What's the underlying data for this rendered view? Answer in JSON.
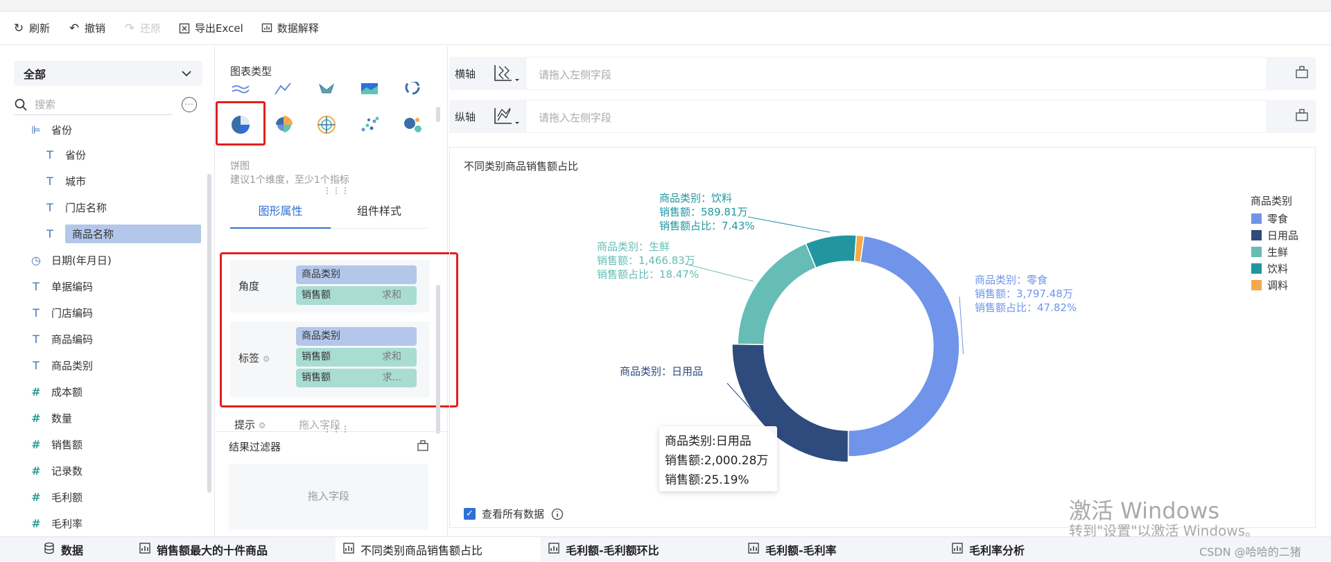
{
  "toolbar": {
    "refresh": "刷新",
    "undo": "撤销",
    "redo": "还原",
    "export": "导出Excel",
    "explain": "数据解释"
  },
  "fields": {
    "scope": "全部",
    "search_placeholder": "搜索",
    "group": "省份",
    "items": [
      {
        "label": "省份",
        "type": "text"
      },
      {
        "label": "城市",
        "type": "text"
      },
      {
        "label": "门店名称",
        "type": "text"
      },
      {
        "label": "商品名称",
        "type": "text",
        "selected": true
      },
      {
        "label": "日期(年月日)",
        "type": "date"
      },
      {
        "label": "单据编码",
        "type": "text"
      },
      {
        "label": "门店编码",
        "type": "text"
      },
      {
        "label": "商品编码",
        "type": "text"
      },
      {
        "label": "商品类别",
        "type": "text"
      },
      {
        "label": "成本额",
        "type": "number"
      },
      {
        "label": "数量",
        "type": "number"
      },
      {
        "label": "销售额",
        "type": "number"
      },
      {
        "label": "记录数",
        "type": "number"
      },
      {
        "label": "毛利额",
        "type": "number"
      },
      {
        "label": "毛利率",
        "type": "number"
      }
    ]
  },
  "chart_type": {
    "title": "图表类型",
    "selected_name": "饼图",
    "hint": "建议1个维度，至少1个指标",
    "icons": [
      "line-chart-icon",
      "area-line-icon",
      "map-icon",
      "area-chart-icon",
      "ring-icon",
      "pie-chart-icon",
      "rose-chart-icon",
      "radar-chart-icon",
      "scatter-icon",
      "bubble-icon"
    ]
  },
  "tabs": {
    "graph_props": "图形属性",
    "component_style": "组件样式"
  },
  "props": {
    "angle_label": "角度",
    "angle_chips": [
      {
        "label": "商品类别",
        "kind": "dim",
        "agg": ""
      },
      {
        "label": "销售额",
        "kind": "mea",
        "agg": "求和"
      }
    ],
    "tag_label": "标签",
    "tag_chips": [
      {
        "label": "商品类别",
        "kind": "dim",
        "agg": ""
      },
      {
        "label": "销售额",
        "kind": "mea",
        "agg": "求和"
      },
      {
        "label": "销售额",
        "kind": "mea",
        "agg": "求..."
      }
    ],
    "tip_label": "提示",
    "tip_drop": "拖入字段"
  },
  "filter": {
    "title": "结果过滤器",
    "drop": "拖入字段"
  },
  "axes": {
    "x_label": "横轴",
    "y_label": "纵轴",
    "drop_placeholder": "请拖入左侧字段"
  },
  "chart_data": {
    "type": "pie",
    "title": "不同类别商品销售额占比",
    "legend_title": "商品类别",
    "categories": [
      "零食",
      "日用品",
      "生鲜",
      "饮料",
      "调料"
    ],
    "values": [
      3797.48,
      2000.28,
      1466.83,
      589.81,
      87
    ],
    "percents": [
      47.82,
      25.19,
      18.47,
      7.43,
      1.09
    ],
    "colors": [
      "#7094ea",
      "#2f4a7c",
      "#66bdb5",
      "#2196a0",
      "#f5a94a"
    ],
    "labels": [
      [
        "商品类别：零食",
        "销售额：3,797.48万",
        "销售额占比：47.82%"
      ],
      [
        "商品类别：日用品",
        "",
        ""
      ],
      [
        "商品类别：生鲜",
        "销售额：1,466.83万",
        "销售额占比：18.47%"
      ],
      [
        "商品类别：饮料",
        "销售额：589.81万",
        "销售额占比：7.43%"
      ]
    ],
    "legend_position": "top-right",
    "donut": true
  },
  "tooltip": {
    "line1": "商品类别:日用品",
    "line2": "销售额:2,000.28万",
    "line3": "销售额:25.19%"
  },
  "check_all": "查看所有数据",
  "watermark": {
    "line1": "激活 Windows",
    "line2": "转到\"设置\"以激活 Windows。"
  },
  "bottom_tabs": [
    {
      "label": "数据",
      "active": false
    },
    {
      "label": "销售额最大的十件商品",
      "active": false
    },
    {
      "label": "不同类别商品销售额占比",
      "active": true
    },
    {
      "label": "毛利额-毛利额环比",
      "active": false
    },
    {
      "label": "毛利额-毛利率",
      "active": false
    },
    {
      "label": "毛利率分析",
      "active": false
    }
  ],
  "csdn": "CSDN @哈哈的二猪"
}
